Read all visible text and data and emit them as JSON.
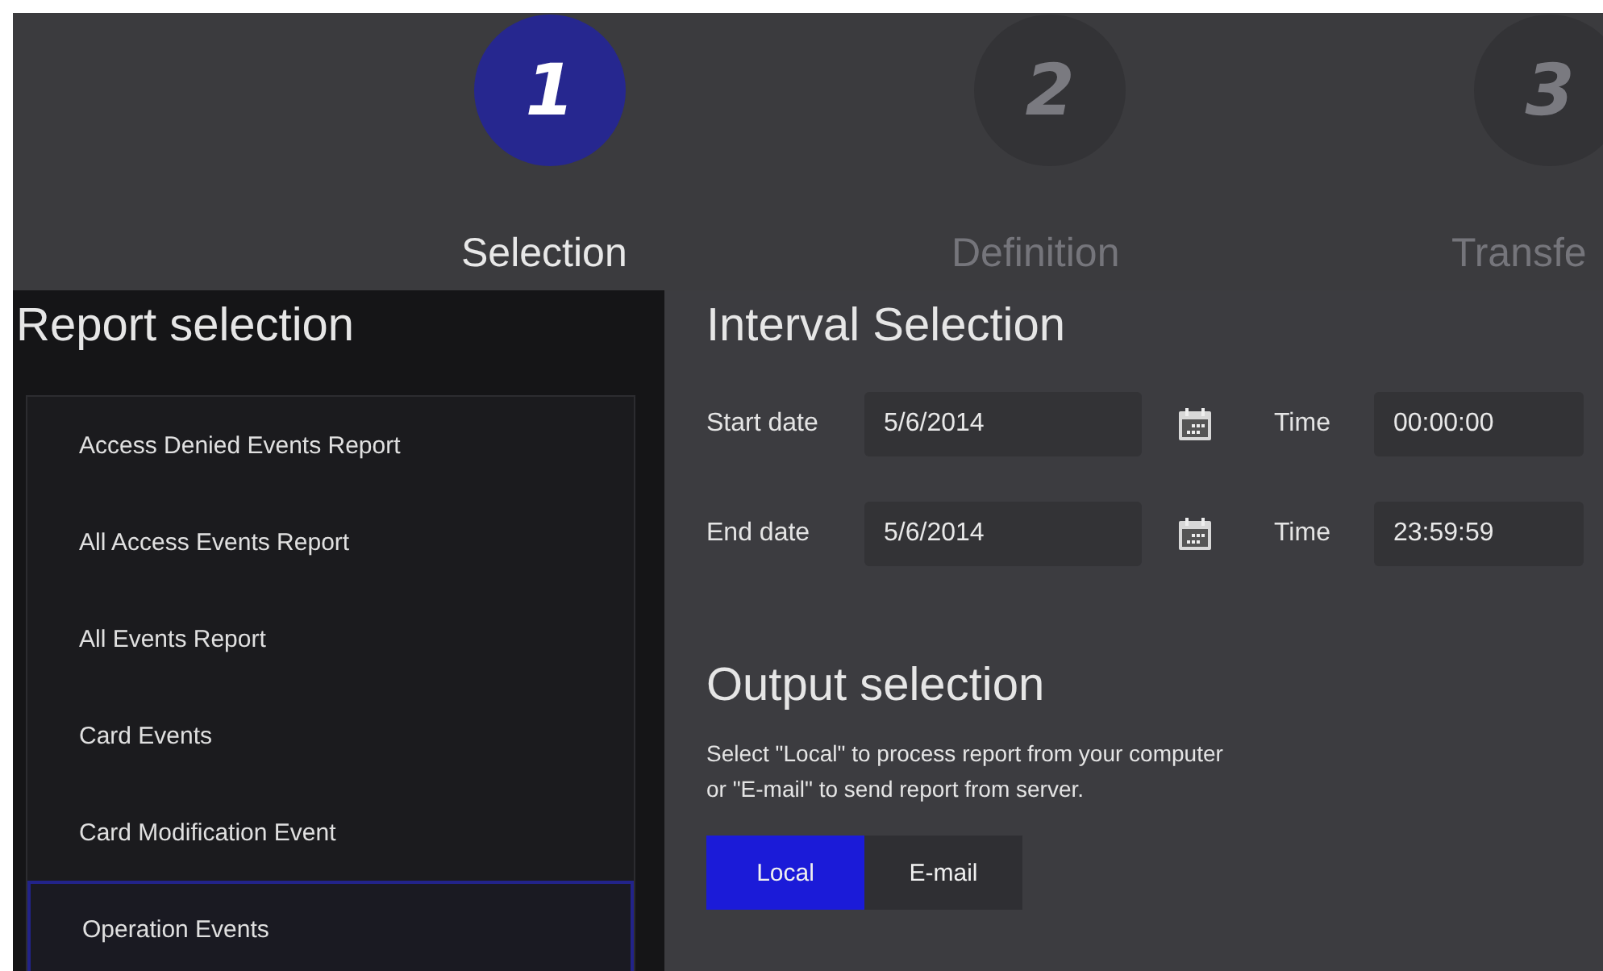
{
  "steps": [
    {
      "number": "1",
      "label": "Selection",
      "selected": true
    },
    {
      "number": "2",
      "label": "Definition",
      "selected": false
    },
    {
      "number": "3",
      "label": "Transfe",
      "selected": false
    }
  ],
  "report_selection": {
    "title": "Report selection",
    "items": [
      {
        "label": "Access Denied Events Report",
        "selected": false
      },
      {
        "label": "All Access Events Report",
        "selected": false
      },
      {
        "label": "All Events Report",
        "selected": false
      },
      {
        "label": "Card Events",
        "selected": false
      },
      {
        "label": "Card Modification Event",
        "selected": false
      },
      {
        "label": "Operation Events",
        "selected": true
      }
    ]
  },
  "interval_selection": {
    "title": "Interval Selection",
    "rows": [
      {
        "date_label": "Start date",
        "date": "5/6/2014",
        "time_label": "Time",
        "time": "00:00:00"
      },
      {
        "date_label": "End date",
        "date": "5/6/2014",
        "time_label": "Time",
        "time": "23:59:59"
      }
    ]
  },
  "output_selection": {
    "title": "Output selection",
    "description": "Select \"Local\" to process report from your computer\nor \"E-mail\" to send report from server.",
    "options": [
      {
        "label": "Local",
        "selected": true
      },
      {
        "label": "E-mail",
        "selected": false
      }
    ]
  }
}
